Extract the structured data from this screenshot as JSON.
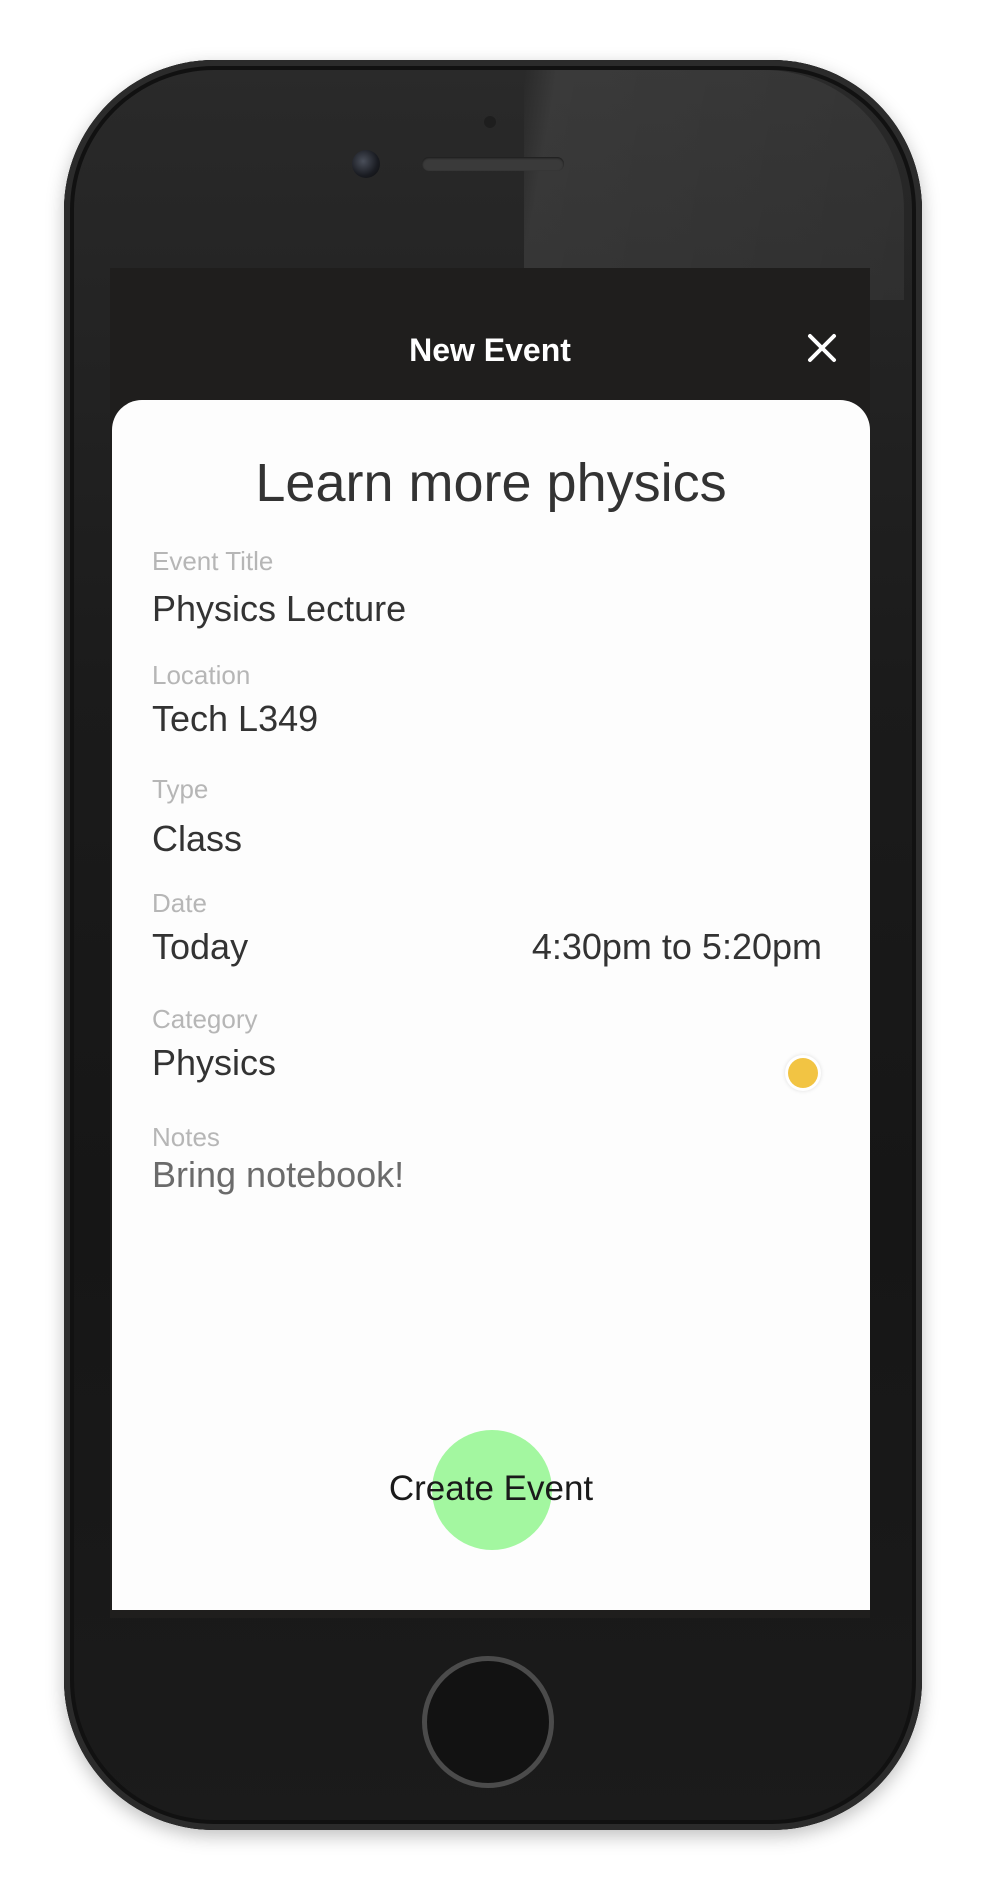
{
  "header": {
    "title": "New Event",
    "close_icon": "close-icon"
  },
  "event": {
    "heading": "Learn more physics",
    "fields": {
      "title_label": "Event Title",
      "title_value": "Physics Lecture",
      "location_label": "Location",
      "location_value": "Tech L349",
      "type_label": "Type",
      "type_value": "Class",
      "date_label": "Date",
      "date_value": "Today",
      "time_value": "4:30pm to 5:20pm",
      "category_label": "Category",
      "category_value": "Physics",
      "category_color": "#f2c443",
      "notes_label": "Notes",
      "notes_value": "Bring notebook!"
    }
  },
  "actions": {
    "create_label": "Create Event"
  },
  "colors": {
    "header_bg": "#1f1e1d",
    "card_bg": "#fdfdfd",
    "touch_indicator": "#a3f7a0",
    "label_text": "#b6b6b6",
    "value_text": "#333333"
  }
}
